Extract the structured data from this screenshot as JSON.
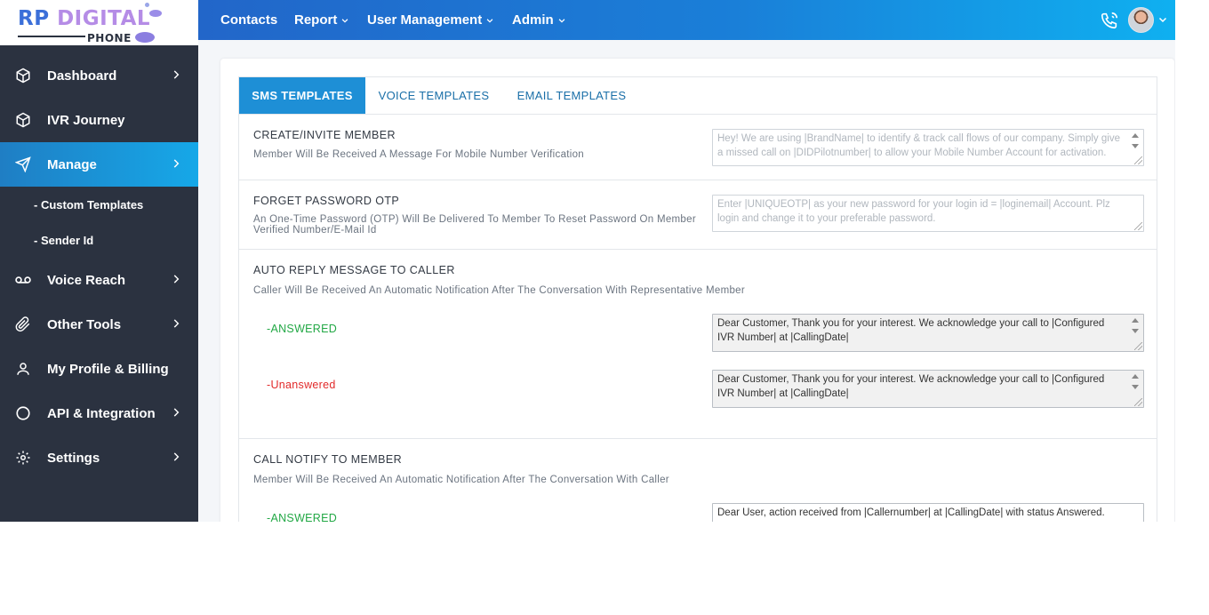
{
  "brand": {
    "logo_rp": "RP",
    "logo_digital": "DIGITAL",
    "logo_phone": "PHONE"
  },
  "sidebar": {
    "items": [
      {
        "label": "Dashboard",
        "icon": "cube-icon",
        "has_chevron": true
      },
      {
        "label": "IVR Journey",
        "icon": "cube-icon",
        "has_chevron": false
      },
      {
        "label": "Manage",
        "icon": "send-icon",
        "has_chevron": true,
        "active": true
      },
      {
        "label": "Voice Reach",
        "icon": "voicemail-icon",
        "has_chevron": true
      },
      {
        "label": "Other Tools",
        "icon": "paperclip-icon",
        "has_chevron": true
      },
      {
        "label": "My Profile & Billing",
        "icon": "user-icon",
        "has_chevron": false
      },
      {
        "label": "API & Integration",
        "icon": "circle-icon",
        "has_chevron": true
      },
      {
        "label": "Settings",
        "icon": "gear-icon",
        "has_chevron": true
      }
    ],
    "sub_items": [
      {
        "label": "- Custom Templates"
      },
      {
        "label": "- Sender Id"
      }
    ]
  },
  "topbar": {
    "menu": [
      {
        "label": "Contacts",
        "dropdown": false
      },
      {
        "label": "Report",
        "dropdown": true
      },
      {
        "label": "User Management",
        "dropdown": true
      },
      {
        "label": "Admin",
        "dropdown": true
      }
    ]
  },
  "tabs": [
    {
      "label": "SMS TEMPLATES",
      "active": true
    },
    {
      "label": "VOICE TEMPLATES",
      "active": false
    },
    {
      "label": "EMAIL TEMPLATES",
      "active": false
    }
  ],
  "sections": {
    "create_invite": {
      "title": "CREATE/INVITE MEMBER",
      "desc": "Member Will Be Received A Message For Mobile Number Verification",
      "placeholder": "Hey! We are using |BrandName| to identify & track call flows of our company. Simply give a missed call on |DIDPilotnumber| to allow your Mobile Number Account for activation."
    },
    "forget_password": {
      "title": "FORGET PASSWORD OTP",
      "desc": "An One-Time Password (OTP) Will Be Delivered To Member To Reset Password On Member Verified Number/E-Mail Id",
      "placeholder": "Enter |UNIQUEOTP| as your new password for your login id = |loginemail| Account. Plz login and change it to your preferable password."
    },
    "auto_reply": {
      "title": "AUTO REPLY MESSAGE TO CALLER",
      "desc": "Caller Will Be Received An Automatic Notification After The Conversation With Representative Member",
      "answered_label": "-ANSWERED",
      "answered_value": "Dear Customer, Thank you for your interest. We acknowledge your call to |Configured IVR Number| at |CallingDate|",
      "unanswered_label": "-Unanswered",
      "unanswered_value": "Dear Customer, Thank you for your interest. We acknowledge your call to |Configured IVR Number| at |CallingDate|"
    },
    "call_notify": {
      "title": "CALL NOTIFY TO MEMBER",
      "desc": "Member Will Be Received An Automatic Notification After The Conversation With Caller",
      "answered_label": "-ANSWERED",
      "answered_value": "Dear User, action received from |Callernumber| at |CallingDate| with status Answered."
    }
  },
  "colors": {
    "sidebar_bg": "#2b3240",
    "accent": "#1e8fd6",
    "answered": "#22a845",
    "unanswered": "#e22a2a"
  }
}
